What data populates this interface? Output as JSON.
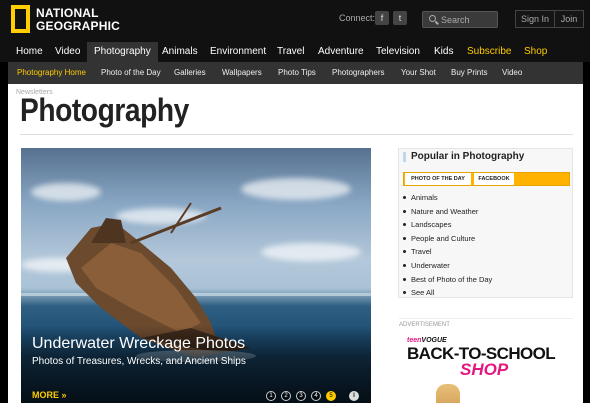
{
  "header": {
    "logo_line1": "NATIONAL",
    "logo_line2": "GEOGRAPHIC",
    "connect_label": "Connect:",
    "social": [
      {
        "icon": "facebook-icon",
        "glyph": "f"
      },
      {
        "icon": "twitter-icon",
        "glyph": "t"
      }
    ],
    "search_placeholder": "Search",
    "sign_in": "Sign In",
    "join": "Join"
  },
  "main_nav": {
    "items": [
      "Home",
      "Video",
      "Photography",
      "Animals",
      "Environment",
      "Travel",
      "Adventure",
      "Television",
      "Kids",
      "Subscribe",
      "Shop"
    ],
    "active": "Photography",
    "highlight_color": "#ffcc00"
  },
  "sub_nav": {
    "items": [
      "Photography Home",
      "Photo of the Day",
      "Galleries",
      "Wallpapers",
      "Photo Tips",
      "Photographers",
      "Your Shot",
      "Buy Prints",
      "Video"
    ],
    "active": "Photography Home"
  },
  "page": {
    "breadcrumb": "Newsletters",
    "title": "Photography"
  },
  "hero": {
    "title": "Underwater Wreckage Photos",
    "subtitle": "Photos of Treasures, Wrecks, and Ancient Ships",
    "more": "MORE »",
    "pager": [
      "1",
      "2",
      "3",
      "4",
      "5"
    ],
    "active_page": "5",
    "play_icon": "pause-icon"
  },
  "popular": {
    "heading": "Popular in Photography",
    "tabs": [
      "PHOTO OF THE DAY",
      "FACEBOOK"
    ],
    "items": [
      "Animals",
      "Nature and Weather",
      "Landscapes",
      "People and Culture",
      "Travel",
      "Underwater",
      "Best of Photo of the Day",
      "See All"
    ]
  },
  "ad": {
    "label": "ADVERTISEMENT",
    "brand_teen": "teen",
    "brand_vogue": "VOGUE",
    "line1": "BACK-TO-SCHOOL",
    "line2": "SHOP"
  }
}
